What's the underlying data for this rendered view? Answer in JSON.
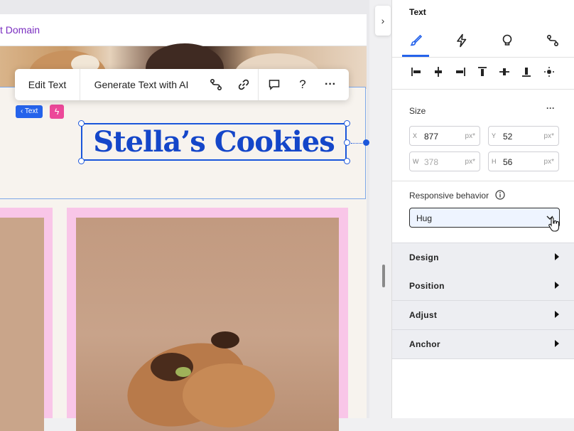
{
  "site": {
    "domain": "t Domain",
    "title": "Stella’s Cookies"
  },
  "tags": {
    "text_tag": "‹ Text",
    "bolt": "ϟ"
  },
  "toolbar": {
    "edit_text": "Edit Text",
    "generate_ai": "Generate Text with AI",
    "help": "?",
    "more": "···"
  },
  "collapse_arrow": "›",
  "panel": {
    "title": "Text",
    "tabs": [
      "design-brush-icon",
      "animation-bolt-icon",
      "ai-bulb-icon",
      "connect-icon"
    ],
    "size_label": "Size",
    "size_more": "···",
    "fields": {
      "x": {
        "key": "X",
        "value": "877",
        "unit": "px*"
      },
      "y": {
        "key": "Y",
        "value": "52",
        "unit": "px*"
      },
      "w": {
        "key": "W",
        "value": "378",
        "unit": "px*"
      },
      "h": {
        "key": "H",
        "value": "56",
        "unit": "px*"
      }
    },
    "responsive_label": "Responsive behavior",
    "responsive_value": "Hug",
    "sections": [
      "Design",
      "Position",
      "Adjust",
      "Anchor"
    ]
  },
  "colors": {
    "accent": "#2563eb",
    "title": "#1446c9",
    "pink": "#f9c6e8",
    "domain": "#7a2ec0"
  }
}
